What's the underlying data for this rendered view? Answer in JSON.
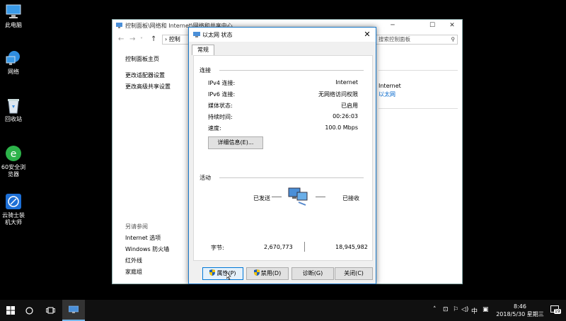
{
  "desktop": {
    "icons": [
      {
        "label": "此电脑"
      },
      {
        "label": "网络"
      },
      {
        "label": "回收站"
      },
      {
        "label": "60安全浏览器"
      },
      {
        "label": "云骑士装机大师"
      }
    ]
  },
  "control_panel": {
    "title": "控制面板\\网络和 Internet\\网络和共享中心",
    "address_arrow": "›",
    "address_text": "控制",
    "search_placeholder": "搜索控制面板",
    "sidebar": {
      "items": [
        "控制面板主页",
        "更改适配器设置",
        "更改高级共享设置"
      ]
    },
    "see_also": {
      "heading": "另请参阅",
      "items": [
        "Internet 选项",
        "Windows 防火墙",
        "红外线",
        "家庭组"
      ]
    },
    "right_panel": {
      "access_type": "Internet",
      "connection_link": "以太网"
    },
    "controls": {
      "minimize": "─",
      "maximize": "☐",
      "close": "✕"
    }
  },
  "dialog": {
    "title": "以太网 状态",
    "close": "✕",
    "tab": "常规",
    "connection": {
      "heading": "连接",
      "rows": [
        {
          "label": "IPv4 连接:",
          "value": "Internet"
        },
        {
          "label": "IPv6 连接:",
          "value": "无网络访问权限"
        },
        {
          "label": "媒体状态:",
          "value": "已启用"
        },
        {
          "label": "持续时间:",
          "value": "00:26:03"
        },
        {
          "label": "速度:",
          "value": "100.0 Mbps"
        }
      ],
      "details_button": "详细信息(E)..."
    },
    "activity": {
      "heading": "活动",
      "sent_label": "已发送",
      "received_label": "已接收",
      "bytes_label": "字节:",
      "bytes_sent": "2,670,773",
      "bytes_received": "18,945,982"
    },
    "buttons": {
      "properties": "属性(P)",
      "disable": "禁用(D)",
      "diagnose": "诊断(G)",
      "close": "关闭(C)"
    }
  },
  "taskbar": {
    "time": "8:46",
    "date": "2018/5/30 星期三",
    "ime": "中",
    "notifications_count": "19"
  },
  "colors": {
    "accent": "#0078d7",
    "link": "#0066cc",
    "taskbar": "#101010"
  }
}
